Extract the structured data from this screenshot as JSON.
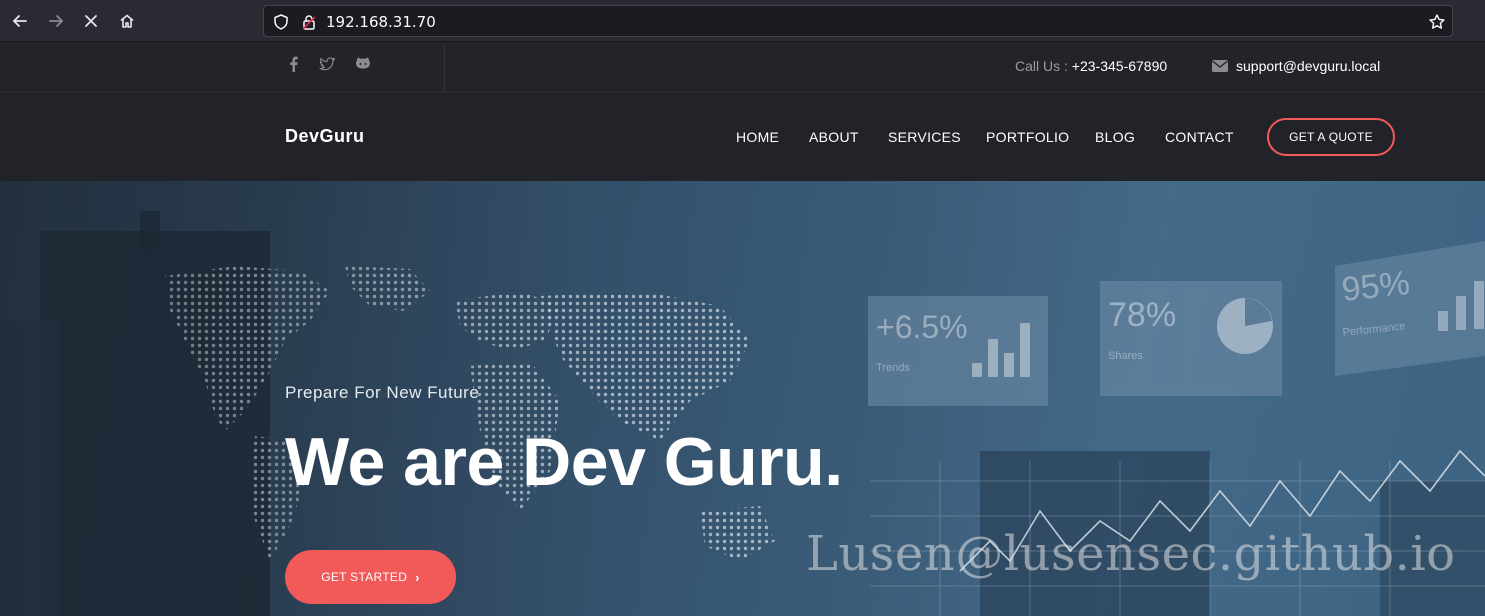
{
  "browser": {
    "url": "192.168.31.70"
  },
  "topbar": {
    "social_icons": [
      "facebook-icon",
      "twitter-icon",
      "github-icon"
    ],
    "call_label": "Call Us : ",
    "call_number": "+23-345-67890",
    "email": "support@devguru.local"
  },
  "header": {
    "logo": "DevGuru",
    "menu": [
      "HOME",
      "ABOUT",
      "SERVICES",
      "PORTFOLIO",
      "BLOG",
      "CONTACT"
    ],
    "quote_button": "GET A QUOTE"
  },
  "hero": {
    "subtitle": "Prepare For New Future",
    "title": "We are Dev Guru.",
    "button": "GET STARTED",
    "panels": [
      {
        "value": "+6.5%",
        "label": "Trends"
      },
      {
        "value": "78%",
        "label": "Shares"
      },
      {
        "value": "95%",
        "label": "Performance"
      }
    ],
    "watermark": "Lusen@lusensec.github.io"
  },
  "colors": {
    "accent": "#f25a5a",
    "header_bg": "#222329",
    "hero_blue": "#3b5d7a"
  }
}
